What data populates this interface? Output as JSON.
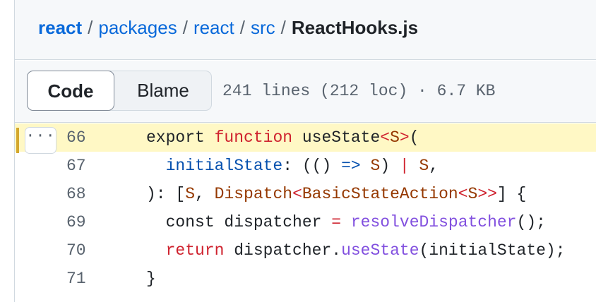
{
  "breadcrumb": {
    "items": [
      "react",
      "packages",
      "react",
      "src"
    ],
    "separator": "/",
    "current": "ReactHooks.js"
  },
  "toolbar": {
    "code_label": "Code",
    "blame_label": "Blame",
    "file_info": "241 lines (212 loc) · 6.7 KB"
  },
  "code": {
    "more_label": "···",
    "highlighted_line": 66,
    "lines": [
      {
        "number": "66",
        "tokens": [
          {
            "t": "export ",
            "c": "plain"
          },
          {
            "t": "function",
            "c": "kw"
          },
          {
            "t": " ",
            "c": "plain"
          },
          {
            "t": "useState",
            "c": "plain"
          },
          {
            "t": "<",
            "c": "kw"
          },
          {
            "t": "S",
            "c": "ty"
          },
          {
            "t": ">",
            "c": "kw"
          },
          {
            "t": "(",
            "c": "plain"
          }
        ]
      },
      {
        "number": "67",
        "tokens": [
          {
            "t": "  ",
            "c": "plain"
          },
          {
            "t": "initialState",
            "c": "pr"
          },
          {
            "t": ": (() ",
            "c": "plain"
          },
          {
            "t": "=>",
            "c": "pr"
          },
          {
            "t": " ",
            "c": "plain"
          },
          {
            "t": "S",
            "c": "ty"
          },
          {
            "t": ") ",
            "c": "plain"
          },
          {
            "t": "|",
            "c": "kw"
          },
          {
            "t": " ",
            "c": "plain"
          },
          {
            "t": "S",
            "c": "ty"
          },
          {
            "t": ",",
            "c": "plain"
          }
        ]
      },
      {
        "number": "68",
        "tokens": [
          {
            "t": "): [",
            "c": "plain"
          },
          {
            "t": "S",
            "c": "ty"
          },
          {
            "t": ", ",
            "c": "plain"
          },
          {
            "t": "Dispatch",
            "c": "ty"
          },
          {
            "t": "<",
            "c": "kw"
          },
          {
            "t": "BasicStateAction",
            "c": "ty"
          },
          {
            "t": "<",
            "c": "kw"
          },
          {
            "t": "S",
            "c": "ty"
          },
          {
            "t": ">>",
            "c": "kw"
          },
          {
            "t": "] {",
            "c": "plain"
          }
        ]
      },
      {
        "number": "69",
        "tokens": [
          {
            "t": "  const dispatcher ",
            "c": "plain"
          },
          {
            "t": "=",
            "c": "kw"
          },
          {
            "t": " ",
            "c": "plain"
          },
          {
            "t": "resolveDispatcher",
            "c": "fn"
          },
          {
            "t": "();",
            "c": "plain"
          }
        ]
      },
      {
        "number": "70",
        "tokens": [
          {
            "t": "  ",
            "c": "plain"
          },
          {
            "t": "return",
            "c": "kw"
          },
          {
            "t": " dispatcher.",
            "c": "plain"
          },
          {
            "t": "useState",
            "c": "fn"
          },
          {
            "t": "(initialState);",
            "c": "plain"
          }
        ]
      },
      {
        "number": "71",
        "tokens": [
          {
            "t": "}",
            "c": "plain"
          }
        ]
      }
    ]
  },
  "colors": {
    "link": "#0969da",
    "keyword": "#cf222e",
    "function": "#8250df",
    "type": "#953800",
    "property": "#0550ae",
    "highlight_bg": "#fff8c5",
    "highlight_bar": "#d4a72c"
  }
}
